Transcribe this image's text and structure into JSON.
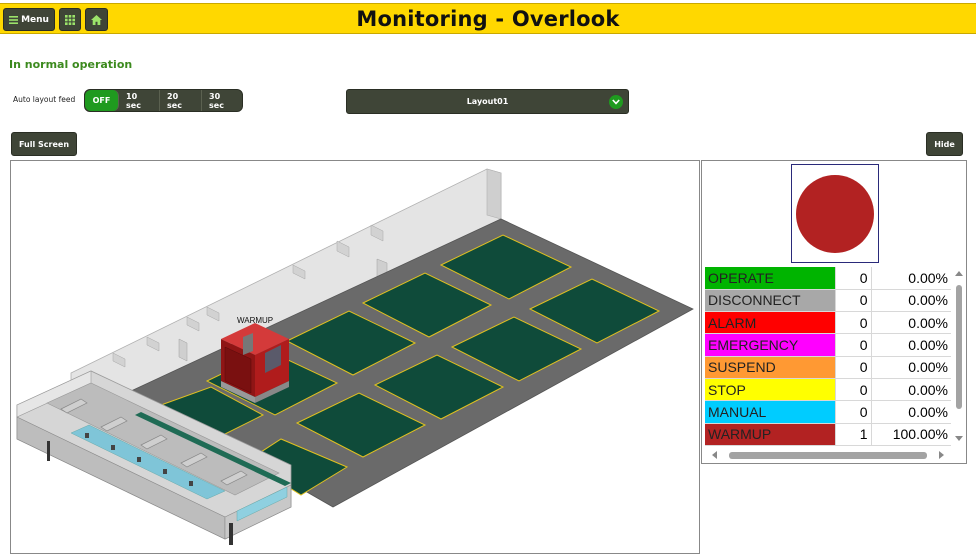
{
  "header": {
    "title": "Monitoring - Overlook",
    "menu_label": "Menu",
    "grid_icon": "grid-icon",
    "home_icon": "home-icon",
    "menu_icon": "hamburger-icon",
    "background": "#ffd800"
  },
  "status": {
    "text": "In normal operation",
    "color": "#3c8a1e"
  },
  "auto_feed": {
    "label": "Auto layout feed",
    "options": [
      "OFF",
      "10 sec",
      "20 sec",
      "30 sec"
    ],
    "selected": "OFF"
  },
  "layout_select": {
    "value": "Layout01",
    "icon": "chevron-down-icon"
  },
  "buttons": {
    "full_screen": "Full Screen",
    "hide": "Hide"
  },
  "floor_view": {
    "machine_label": "WARMUP",
    "machine_color": "#b22222",
    "cell_color": "#0f4b3a"
  },
  "indicator": {
    "color": "#b22222"
  },
  "status_table": [
    {
      "name": "OPERATE",
      "count": "0",
      "percent": "0.00%",
      "color": "#00b400"
    },
    {
      "name": "DISCONNECT",
      "count": "0",
      "percent": "0.00%",
      "color": "#a8a8a8"
    },
    {
      "name": "ALARM",
      "count": "0",
      "percent": "0.00%",
      "color": "#ff0000"
    },
    {
      "name": "EMERGENCY",
      "count": "0",
      "percent": "0.00%",
      "color": "#ff00ff"
    },
    {
      "name": "SUSPEND",
      "count": "0",
      "percent": "0.00%",
      "color": "#ff9933"
    },
    {
      "name": "STOP",
      "count": "0",
      "percent": "0.00%",
      "color": "#ffff00"
    },
    {
      "name": "MANUAL",
      "count": "0",
      "percent": "0.00%",
      "color": "#00ccff"
    },
    {
      "name": "WARMUP",
      "count": "1",
      "percent": "100.00%",
      "color": "#b22222"
    }
  ]
}
